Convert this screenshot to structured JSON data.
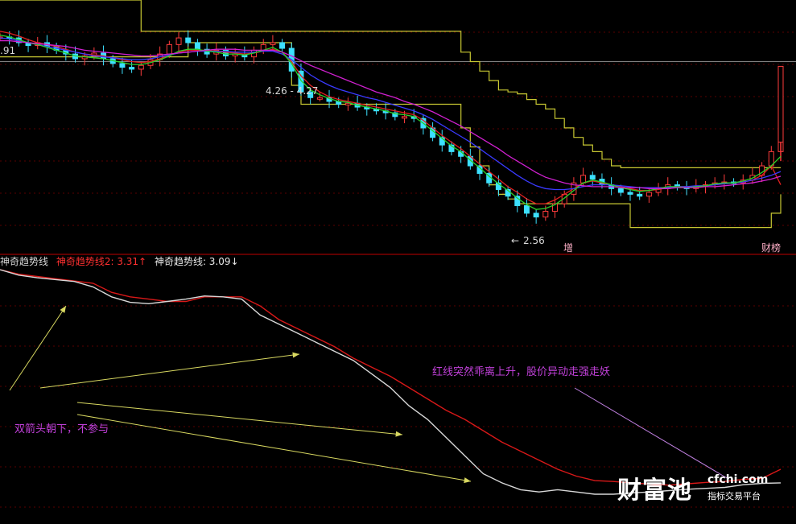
{
  "chart_data": [
    {
      "type": "line",
      "title": "",
      "ylim": [
        2.3,
        4.95
      ],
      "price_labels": {
        "top_left": ".91",
        "high_marker": "4.26 - 4.27",
        "low_marker": "2.56"
      },
      "badges": {
        "zeng": "增",
        "caifu": "财榜"
      },
      "grid": true,
      "series": [
        {
          "role": "close",
          "color": "#00e5ff",
          "values": [
            4.56,
            4.55,
            4.5,
            4.47,
            4.5,
            4.46,
            4.42,
            4.38,
            4.33,
            4.36,
            4.39,
            4.33,
            4.28,
            4.24,
            4.22,
            4.26,
            4.32,
            4.38,
            4.48,
            4.55,
            4.5,
            4.43,
            4.38,
            4.42,
            4.36,
            4.38,
            4.35,
            4.42,
            4.48,
            4.5,
            4.44,
            4.2,
            3.98,
            3.92,
            3.92,
            3.88,
            3.85,
            3.86,
            3.82,
            3.8,
            3.78,
            3.76,
            3.72,
            3.72,
            3.7,
            3.6,
            3.5,
            3.42,
            3.35,
            3.3,
            3.2,
            3.12,
            3.02,
            2.95,
            2.88,
            2.78,
            2.7,
            2.66,
            2.72,
            2.8,
            2.9,
            3.02,
            3.1,
            3.06,
            3.0,
            2.96,
            2.92,
            2.9,
            2.88,
            2.92,
            2.96,
            3.0,
            2.98,
            2.96,
            2.98,
            3.0,
            3.02,
            3.03,
            3.02,
            3.05,
            3.1,
            3.2,
            3.35,
            3.6
          ]
        },
        {
          "role": "ma-red",
          "color": "#e02020",
          "values": [
            4.62,
            4.6,
            4.57,
            4.53,
            4.5,
            4.48,
            4.46,
            4.43,
            4.4,
            4.38,
            4.37,
            4.36,
            4.34,
            4.32,
            4.3,
            4.29,
            4.3,
            4.33,
            4.37,
            4.4,
            4.42,
            4.42,
            4.42,
            4.41,
            4.4,
            4.39,
            4.38,
            4.39,
            4.41,
            4.43,
            4.4,
            4.3,
            4.15,
            4.05,
            3.98,
            3.93,
            3.9,
            3.88,
            3.86,
            3.84,
            3.82,
            3.8,
            3.78,
            3.76,
            3.74,
            3.68,
            3.6,
            3.52,
            3.45,
            3.38,
            3.3,
            3.22,
            3.14,
            3.06,
            2.98,
            2.92,
            2.85,
            2.8,
            2.8,
            2.84,
            2.9,
            2.96,
            3.02,
            3.04,
            3.02,
            3.0,
            2.98,
            2.96,
            2.94,
            2.94,
            2.95,
            2.97,
            2.98,
            2.98,
            2.98,
            2.99,
            3.0,
            3.01,
            3.02,
            3.03,
            3.05,
            3.1,
            3.2,
            3.0
          ]
        },
        {
          "role": "ma-blue",
          "color": "#3a3aff",
          "values": [
            4.55,
            4.54,
            4.52,
            4.5,
            4.48,
            4.46,
            4.44,
            4.42,
            4.4,
            4.38,
            4.36,
            4.35,
            4.34,
            4.33,
            4.32,
            4.32,
            4.33,
            4.35,
            4.37,
            4.39,
            4.4,
            4.41,
            4.41,
            4.41,
            4.41,
            4.4,
            4.4,
            4.4,
            4.41,
            4.41,
            4.38,
            4.32,
            4.24,
            4.16,
            4.1,
            4.05,
            4.01,
            3.98,
            3.95,
            3.92,
            3.9,
            3.87,
            3.84,
            3.81,
            3.78,
            3.74,
            3.69,
            3.63,
            3.57,
            3.51,
            3.45,
            3.38,
            3.31,
            3.24,
            3.17,
            3.1,
            3.04,
            2.99,
            2.96,
            2.95,
            2.95,
            2.96,
            2.98,
            3.0,
            3.0,
            3.0,
            2.99,
            2.98,
            2.97,
            2.97,
            2.97,
            2.97,
            2.98,
            2.98,
            2.99,
            2.99,
            3.0,
            3.01,
            3.02,
            3.03,
            3.05,
            3.07,
            3.1,
            3.14
          ]
        },
        {
          "role": "ma-green",
          "color": "#2ad02a",
          "values": [
            4.58,
            4.56,
            4.53,
            4.5,
            4.48,
            4.45,
            4.42,
            4.39,
            4.36,
            4.35,
            4.34,
            4.33,
            4.31,
            4.29,
            4.27,
            4.27,
            4.29,
            4.32,
            4.36,
            4.41,
            4.43,
            4.43,
            4.41,
            4.4,
            4.38,
            4.38,
            4.37,
            4.39,
            4.42,
            4.45,
            4.4,
            4.28,
            4.1,
            4.0,
            3.95,
            3.91,
            3.88,
            3.87,
            3.84,
            3.82,
            3.8,
            3.78,
            3.75,
            3.74,
            3.72,
            3.65,
            3.57,
            3.49,
            3.41,
            3.35,
            3.26,
            3.18,
            3.09,
            3.01,
            2.94,
            2.86,
            2.79,
            2.74,
            2.75,
            2.79,
            2.86,
            2.94,
            3.02,
            3.05,
            3.03,
            3.0,
            2.97,
            2.95,
            2.93,
            2.94,
            2.96,
            2.98,
            2.98,
            2.97,
            2.98,
            2.99,
            3.01,
            3.02,
            3.02,
            3.04,
            3.07,
            3.13,
            3.2,
            3.3
          ]
        },
        {
          "role": "ma-magenta",
          "color": "#d020d0",
          "values": [
            4.52,
            4.52,
            4.51,
            4.5,
            4.49,
            4.48,
            4.47,
            4.46,
            4.44,
            4.42,
            4.41,
            4.4,
            4.39,
            4.38,
            4.37,
            4.36,
            4.36,
            4.37,
            4.38,
            4.39,
            4.4,
            4.41,
            4.42,
            4.43,
            4.43,
            4.43,
            4.42,
            4.42,
            4.42,
            4.42,
            4.4,
            4.36,
            4.31,
            4.26,
            4.22,
            4.18,
            4.14,
            4.1,
            4.06,
            4.02,
            3.98,
            3.95,
            3.92,
            3.88,
            3.85,
            3.81,
            3.77,
            3.72,
            3.67,
            3.62,
            3.56,
            3.5,
            3.44,
            3.38,
            3.31,
            3.25,
            3.19,
            3.13,
            3.08,
            3.05,
            3.02,
            3.0,
            2.99,
            2.98,
            2.98,
            2.98,
            2.97,
            2.97,
            2.97,
            2.96,
            2.96,
            2.96,
            2.97,
            2.97,
            2.97,
            2.98,
            2.98,
            2.99,
            3.0,
            3.01,
            3.02,
            3.04,
            3.06,
            3.09
          ]
        }
      ],
      "bands": {
        "upper": {
          "color": "#c8c832",
          "values": [
            4.95,
            4.95,
            4.95,
            4.95,
            4.95,
            4.95,
            4.95,
            4.95,
            4.95,
            4.95,
            4.95,
            4.95,
            4.95,
            4.95,
            4.95,
            4.62,
            4.62,
            4.62,
            4.62,
            4.62,
            4.62,
            4.62,
            4.62,
            4.62,
            4.62,
            4.62,
            4.62,
            4.62,
            4.62,
            4.62,
            4.62,
            4.62,
            4.62,
            4.62,
            4.62,
            4.62,
            4.62,
            4.62,
            4.62,
            4.62,
            4.62,
            4.62,
            4.62,
            4.62,
            4.62,
            4.62,
            4.62,
            4.62,
            4.62,
            4.4,
            4.3,
            4.2,
            4.1,
            4.0,
            3.98,
            3.96,
            3.9,
            3.85,
            3.8,
            3.7,
            3.6,
            3.5,
            3.42,
            3.35,
            3.27,
            3.2,
            3.18,
            3.18,
            3.18,
            3.18,
            3.18,
            3.18,
            3.18,
            3.18,
            3.18,
            3.18,
            3.18,
            3.18,
            3.18,
            3.18,
            3.18,
            3.18,
            3.18,
            3.18
          ]
        },
        "lower": {
          "color": "#c8c832",
          "values": [
            4.35,
            4.35,
            4.35,
            4.35,
            4.35,
            4.35,
            4.35,
            4.35,
            4.35,
            4.35,
            4.35,
            4.35,
            4.35,
            4.35,
            4.35,
            4.35,
            4.35,
            4.35,
            4.35,
            4.35,
            4.5,
            4.5,
            4.5,
            4.5,
            4.5,
            4.5,
            4.5,
            4.5,
            4.5,
            4.5,
            4.5,
            4.05,
            3.85,
            3.85,
            3.85,
            3.85,
            3.85,
            3.85,
            3.85,
            3.85,
            3.85,
            3.85,
            3.85,
            3.85,
            3.85,
            3.85,
            3.85,
            3.85,
            3.85,
            3.6,
            3.4,
            3.2,
            3.0,
            2.9,
            2.85,
            2.8,
            2.8,
            2.8,
            2.8,
            2.8,
            2.8,
            2.8,
            2.8,
            2.8,
            2.8,
            2.8,
            2.8,
            2.55,
            2.55,
            2.55,
            2.55,
            2.55,
            2.55,
            2.55,
            2.55,
            2.55,
            2.55,
            2.55,
            2.55,
            2.55,
            2.55,
            2.55,
            2.7,
            2.9
          ]
        },
        "ref_level": {
          "color": "#808080",
          "value": 4.3
        }
      }
    },
    {
      "type": "line",
      "title": "",
      "ylim": [
        3.0,
        3.55
      ],
      "grid": true,
      "legend": [
        {
          "text": "神奇趋势线",
          "color": "#d8d8d8"
        },
        {
          "text": "神奇趋势线2: 3.31↑",
          "color": "#ff3030"
        },
        {
          "text": "神奇趋势线: 3.09↓",
          "color": "#e8e8e8"
        }
      ],
      "series": [
        {
          "name": "神奇趋势线2",
          "color": "#d81818",
          "values": [
            3.55,
            3.54,
            3.535,
            3.53,
            3.525,
            3.52,
            3.5,
            3.49,
            3.485,
            3.48,
            3.48,
            3.49,
            3.49,
            3.49,
            3.47,
            3.44,
            3.42,
            3.4,
            3.38,
            3.355,
            3.335,
            3.315,
            3.29,
            3.265,
            3.24,
            3.22,
            3.195,
            3.17,
            3.15,
            3.13,
            3.11,
            3.095,
            3.085,
            3.083,
            3.08,
            3.077,
            3.075,
            3.078,
            3.081,
            3.083,
            3.088,
            3.09,
            3.11
          ]
        },
        {
          "name": "神奇趋势线",
          "color": "#d8d8d8",
          "values": [
            3.55,
            3.538,
            3.532,
            3.528,
            3.524,
            3.512,
            3.49,
            3.478,
            3.475,
            3.48,
            3.485,
            3.492,
            3.49,
            3.485,
            3.45,
            3.43,
            3.41,
            3.39,
            3.37,
            3.35,
            3.32,
            3.29,
            3.25,
            3.22,
            3.18,
            3.14,
            3.1,
            3.08,
            3.065,
            3.06,
            3.065,
            3.06,
            3.055,
            3.055,
            3.058,
            3.06,
            3.063,
            3.066,
            3.068,
            3.07,
            3.076,
            3.079,
            3.08
          ]
        }
      ],
      "annotations": [
        {
          "text": "红线突然乖离上升，股价异动走强走妖",
          "color": "#c040d8"
        },
        {
          "text": "双箭头朝下，不参与",
          "color": "#c040d8"
        }
      ]
    }
  ],
  "logo": {
    "brand": "财富池",
    "domain": "cfchi.com",
    "tagline": "指标交易平台"
  }
}
